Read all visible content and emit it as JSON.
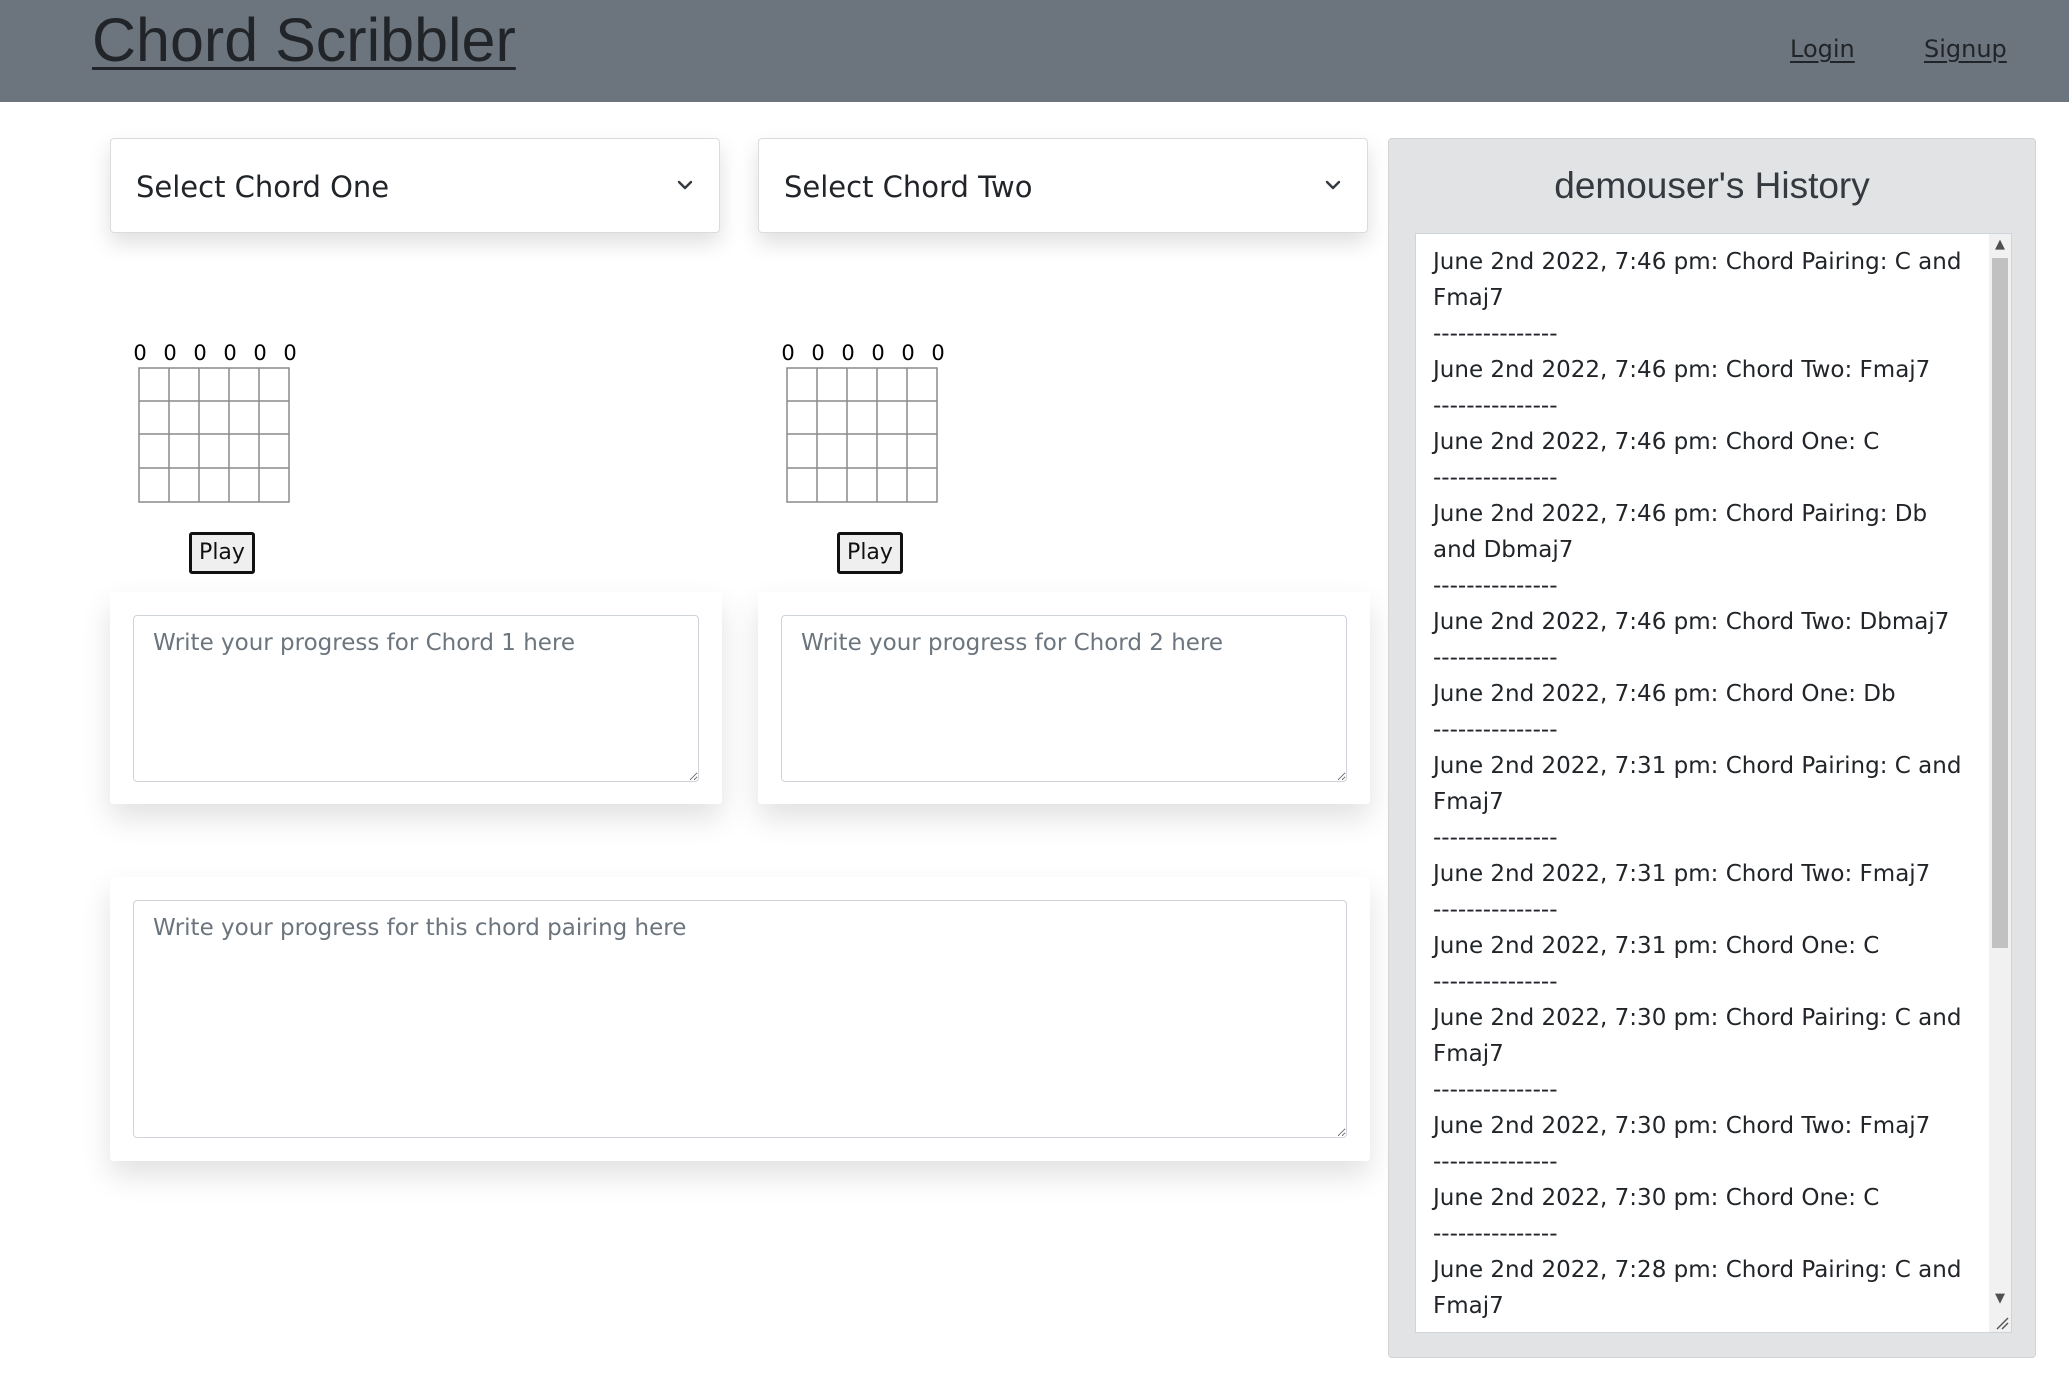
{
  "header": {
    "brand": "Chord Scribbler",
    "login": "Login",
    "signup": "Signup"
  },
  "chord_one": {
    "select_label": "Select Chord One",
    "fret_numbers": [
      "0",
      "0",
      "0",
      "0",
      "0",
      "0"
    ],
    "play_label": "Play",
    "notes_placeholder": "Write your progress for Chord 1 here"
  },
  "chord_two": {
    "select_label": "Select Chord Two",
    "fret_numbers": [
      "0",
      "0",
      "0",
      "0",
      "0",
      "0"
    ],
    "play_label": "Play",
    "notes_placeholder": "Write your progress for Chord 2 here"
  },
  "pairing": {
    "notes_placeholder": "Write your progress for this chord pairing here"
  },
  "history": {
    "title": "demouser's History",
    "separator": "---------------",
    "entries": [
      "June 2nd 2022, 7:46 pm: Chord Pairing: C and Fmaj7",
      "June 2nd 2022, 7:46 pm: Chord Two: Fmaj7",
      "June 2nd 2022, 7:46 pm: Chord One: C",
      "June 2nd 2022, 7:46 pm: Chord Pairing: Db and Dbmaj7",
      "June 2nd 2022, 7:46 pm: Chord Two: Dbmaj7",
      "June 2nd 2022, 7:46 pm: Chord One: Db",
      "June 2nd 2022, 7:31 pm: Chord Pairing: C and Fmaj7",
      "June 2nd 2022, 7:31 pm: Chord Two: Fmaj7",
      "June 2nd 2022, 7:31 pm: Chord One: C",
      "June 2nd 2022, 7:30 pm: Chord Pairing: C and Fmaj7",
      "June 2nd 2022, 7:30 pm: Chord Two: Fmaj7",
      "June 2nd 2022, 7:30 pm: Chord One: C",
      "June 2nd 2022, 7:28 pm: Chord Pairing: C and Fmaj7"
    ]
  },
  "colors": {
    "navbar": "#6c757d",
    "history_panel": "#e2e3e5",
    "text": "#212529",
    "placeholder": "#6c757d"
  }
}
